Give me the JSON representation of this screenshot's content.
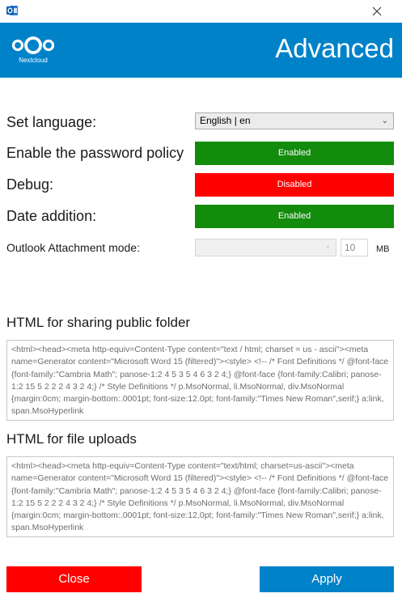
{
  "window": {
    "app_icon": "outlook-icon",
    "close_icon": "close-icon"
  },
  "header": {
    "logo_icon": "nextcloud-logo-icon",
    "logo_text": "Nextcloud",
    "title": "Advanced",
    "background": "#0082c9"
  },
  "settings": {
    "language": {
      "label": "Set language:",
      "value": "English | en"
    },
    "password_policy": {
      "label": "Enable the password policy",
      "value": "Enabled",
      "color": "#138b0c"
    },
    "debug": {
      "label": "Debug:",
      "value": "Disabled",
      "color": "#ff0000"
    },
    "date_addition": {
      "label": "Date addition:",
      "value": "Enabled",
      "color": "#138b0c"
    },
    "attachment_mode": {
      "label": "Outlook Attachment mode:",
      "value": "",
      "size": "10",
      "unit": "MB"
    }
  },
  "sharing_html": {
    "title": "HTML for sharing public folder",
    "content": "<html><head><meta http-equiv=Content-Type content=\"text / html; charset = us - ascii\"><meta name=Generator content=\"Microsoft Word 15 (filtered)\"><style> <!-- /* Font Definitions */ @font-face {font-family:\"Cambria Math\"; panose-1:2 4 5 3 5 4 6 3 2 4;} @font-face {font-family:Calibri; panose-1:2 15 5 2 2 2 4 3 2 4;} /* Style Definitions */ p.MsoNormal, li.MsoNormal, div.MsoNormal {margin:0cm; margin-bottom:.0001pt; font-size:12.0pt; font-family:\"Times New Roman\",serif;} a:link, span.MsoHyperlink"
  },
  "uploads_html": {
    "title": "HTML for file uploads",
    "content": "<html><head><meta http-equiv=Content-Type content=\"text/html; charset=us-ascii\"><meta name=Generator content=\"Microsoft Word 15 (filtered)\"><style> <!-- /* Font Definitions */ @font-face {font-family:\"Cambria Math\"; panose-1:2 4 5 3 5 4 6 3 2 4;} @font-face {font-family:Calibri; panose-1:2 15 5 2 2 2 4 3 2 4;} /* Style Definitions */ p.MsoNormal, li.MsoNormal, div.MsoNormal {margin:0cm; margin-bottom:.0001pt; font-size:12.0pt; font-family:\"Times New Roman\",serif;} a:link, span.MsoHyperlink"
  },
  "buttons": {
    "close": {
      "label": "Close",
      "color": "#ff0000"
    },
    "apply": {
      "label": "Apply",
      "color": "#0082c9"
    }
  }
}
